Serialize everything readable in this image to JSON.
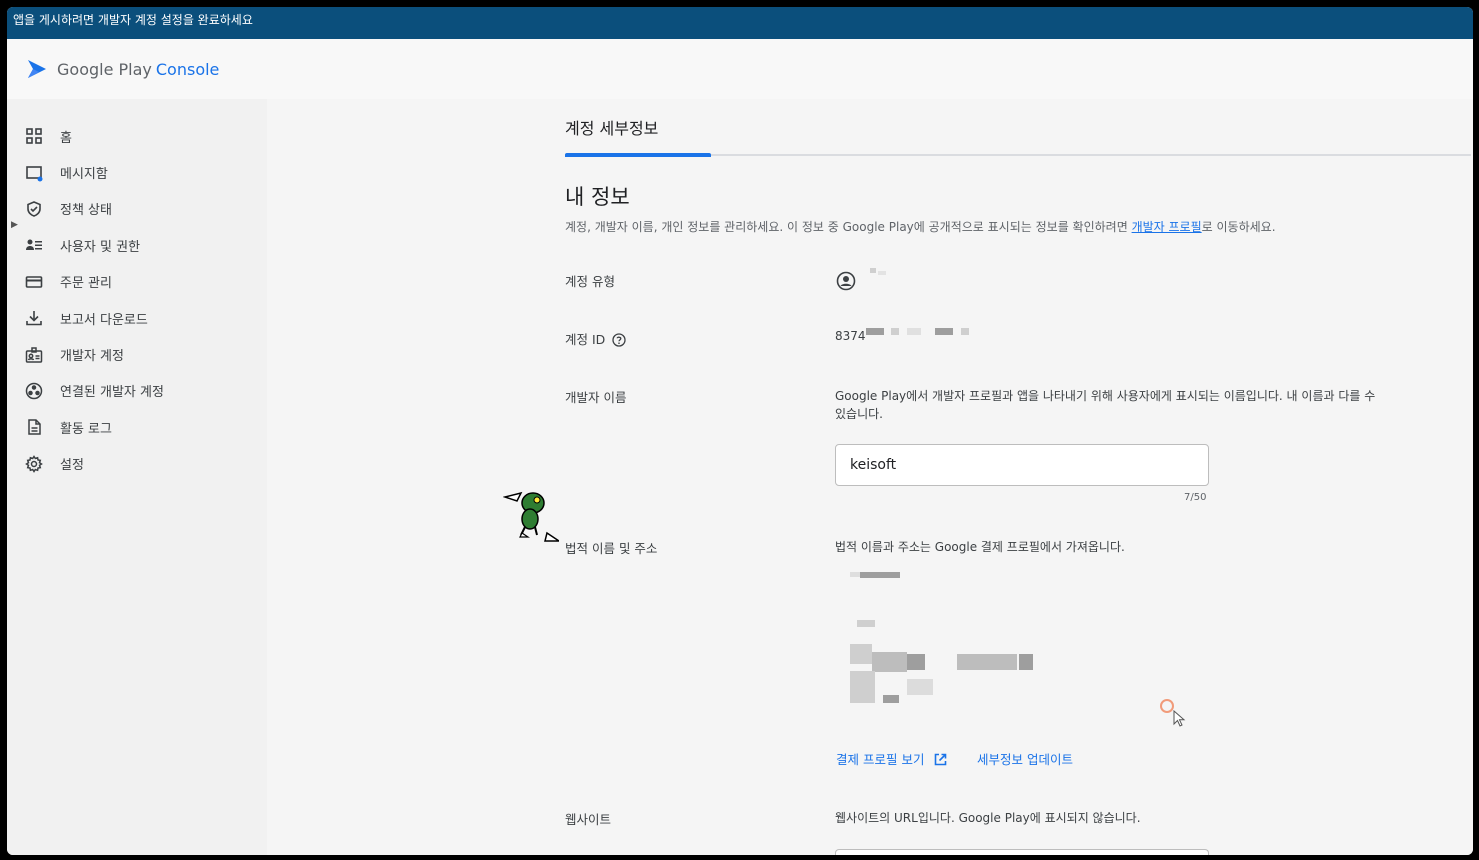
{
  "banner": {
    "text": "앱을 게시하려면 개발자 계정 설정을 완료하세요"
  },
  "brand": {
    "google": "Google Play",
    "console": "Console"
  },
  "sidebar": {
    "items": [
      {
        "label": "홈",
        "icon": "grid-icon"
      },
      {
        "label": "메시지함",
        "icon": "inbox-icon"
      },
      {
        "label": "정책 상태",
        "icon": "shield-icon"
      },
      {
        "label": "사용자 및 권한",
        "icon": "users-icon"
      },
      {
        "label": "주문 관리",
        "icon": "card-icon"
      },
      {
        "label": "보고서 다운로드",
        "icon": "download-icon"
      },
      {
        "label": "개발자 계정",
        "icon": "badge-icon"
      },
      {
        "label": "연결된 개발자 계정",
        "icon": "linked-icon"
      },
      {
        "label": "활동 로그",
        "icon": "document-icon"
      },
      {
        "label": "설정",
        "icon": "gear-icon"
      }
    ]
  },
  "main": {
    "page_title": "계정 세부정보",
    "section_title": "내 정보",
    "section_desc_prefix": "계정, 개발자 이름, 개인 정보를 관리하세요. 이 정보 중 Google Play에 공개적으로 표시되는 정보를 확인하려면 ",
    "section_desc_link": "개발자 프로필",
    "section_desc_suffix": "로 이동하세요.",
    "account_type_label": "계정 유형",
    "account_id_label": "계정 ID",
    "account_id_value": "8374",
    "developer_name_label": "개발자 이름",
    "developer_name_desc": "Google Play에서 개발자 프로필과 앱을 나타내기 위해 사용자에게 표시되는 이름입니다. 내 이름과 다를 수 있습니다.",
    "developer_name_value": "keisoft",
    "developer_name_counter": "7/50",
    "legal_label": "법적 이름 및 주소",
    "legal_desc": "법적 이름과 주소는 Google 결제 프로필에서 가져옵니다.",
    "payments_link": "결제 프로필 보기",
    "update_link": "세부정보 업데이트",
    "website_label": "웹사이트",
    "website_desc": "웹사이트의 URL입니다. Google Play에 표시되지 않습니다."
  },
  "colors": {
    "banner": "#0b4f7c",
    "accent": "#1a73e8"
  }
}
